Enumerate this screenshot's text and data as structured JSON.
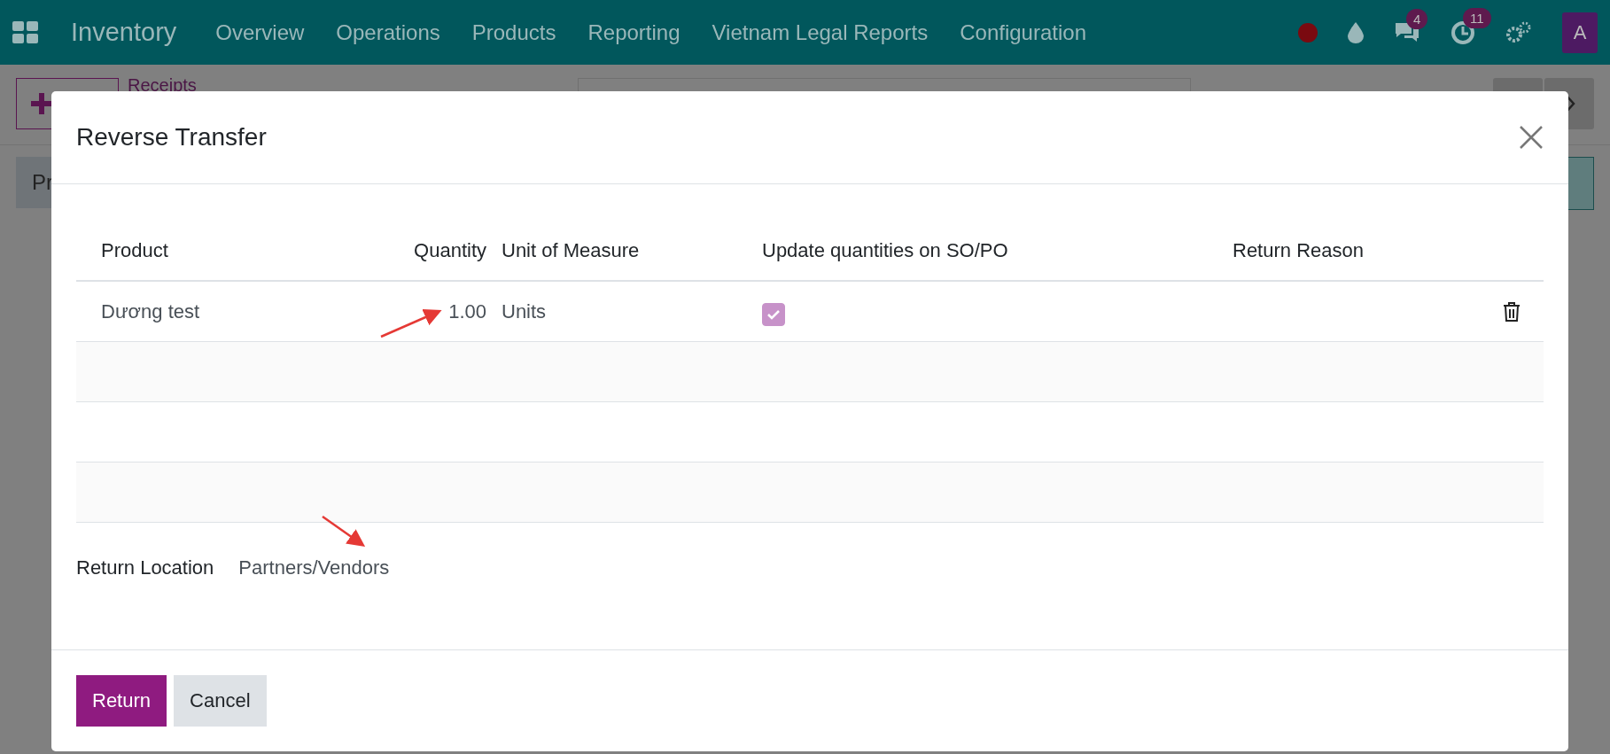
{
  "navbar": {
    "app_name": "Inventory",
    "menu": [
      "Overview",
      "Operations",
      "Products",
      "Reporting",
      "Vietnam Legal Reports",
      "Configuration"
    ],
    "message_count": "4",
    "activity_count": "11",
    "avatar": "A"
  },
  "background": {
    "breadcrumb": "Receipts",
    "tab_fragment": "Pr"
  },
  "dialog": {
    "title": "Reverse Transfer",
    "columns": [
      "Product",
      "Quantity",
      "Unit of Measure",
      "Update quantities on SO/PO",
      "Return Reason"
    ],
    "rows": [
      {
        "product": "Dương test",
        "quantity": "1.00",
        "unit": "Units",
        "update_quantities": true
      }
    ],
    "return_location": {
      "label": "Return Location",
      "value": "Partners/Vendors"
    },
    "buttons": [
      {
        "label": "Return",
        "kind": "primary"
      },
      {
        "label": "Cancel",
        "kind": "secondary"
      }
    ]
  }
}
